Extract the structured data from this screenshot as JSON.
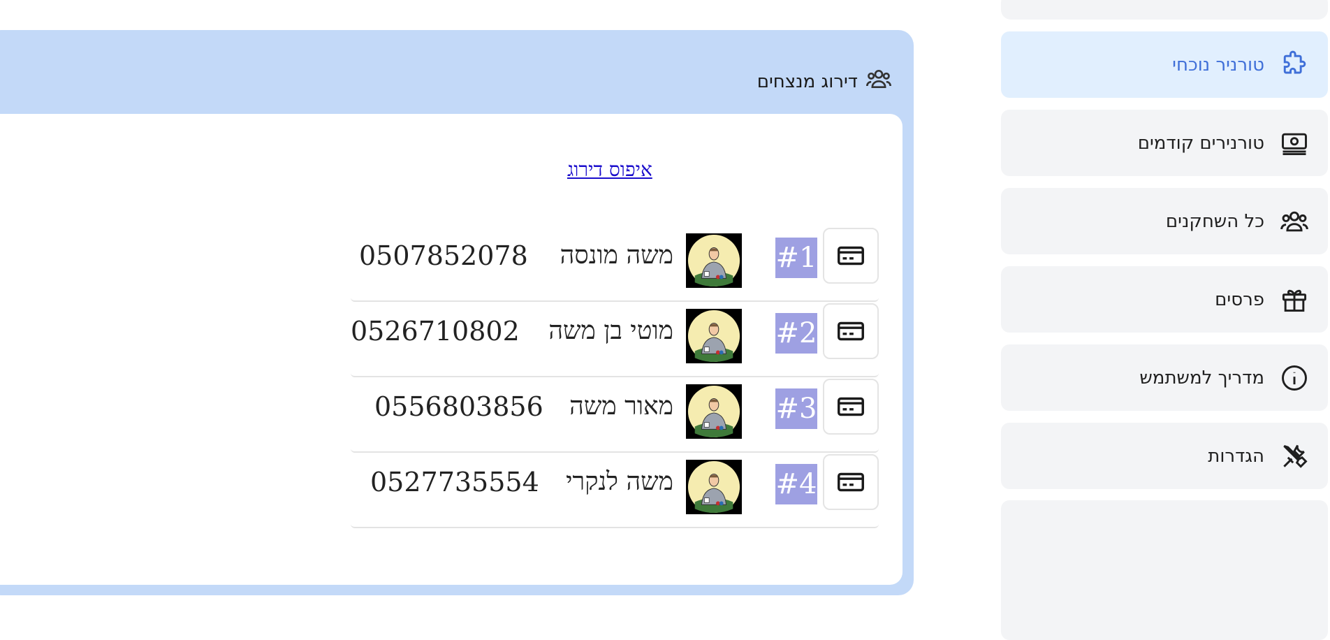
{
  "sidebar": {
    "items": [
      {
        "label": "טורניר נוכחי",
        "icon": "puzzle-icon",
        "active": true
      },
      {
        "label": "טורנירים קודמים",
        "icon": "money-icon",
        "active": false
      },
      {
        "label": "כל השחקנים",
        "icon": "users-icon",
        "active": false
      },
      {
        "label": "פרסים",
        "icon": "gift-icon",
        "active": false
      },
      {
        "label": "מדריך למשתמש",
        "icon": "info-icon",
        "active": false
      },
      {
        "label": "הגדרות",
        "icon": "tools-icon",
        "active": false
      }
    ],
    "active_color": "#3f6fd8",
    "active_bg": "#e1effe"
  },
  "panel": {
    "title": "דירוג מנצחים",
    "icon": "users-icon",
    "reset_link": "איפוס דירוג",
    "bg_color": "#c3d9f8"
  },
  "ranking": [
    {
      "rank": "#1",
      "name": "משה מונסה",
      "phone": "0507852078"
    },
    {
      "rank": "#2",
      "name": "מוטי בן משה",
      "phone": "0526710802"
    },
    {
      "rank": "#3",
      "name": "מאור משה",
      "phone": "0556803856"
    },
    {
      "rank": "#4",
      "name": "משה לנקרי",
      "phone": "0527735554"
    }
  ],
  "badge_color": "#9ea0e2"
}
